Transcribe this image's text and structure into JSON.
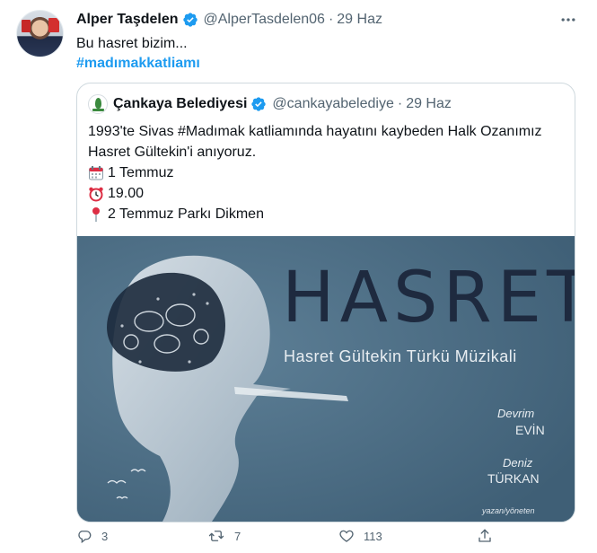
{
  "author": {
    "name": "Alper Taşdelen",
    "handle": "@AlperTasdelen06",
    "separator": "·",
    "date": "29 Haz"
  },
  "tweet": {
    "text": "Bu hasret bizim...",
    "hashtag": "#madımakkatliamı"
  },
  "quoted": {
    "name": "Çankaya Belediyesi",
    "handle": "@cankayabelediye",
    "separator": "·",
    "date": "29 Haz",
    "line1": "1993'te Sivas #Madımak katliamında hayatını kaybeden Halk Ozanımız",
    "line2": "Hasret Gültekin'i anıyoruz.",
    "event_date": "1 Temmuz",
    "event_time": "19.00",
    "event_place": "2 Temmuz Parkı Dikmen",
    "media": {
      "title": "HASRET",
      "subtitle": "Hasret Gültekin Türkü Müzikali",
      "person1_first": "Devrim",
      "person1_last": "EVİN",
      "person2_first": "Deniz",
      "person2_last": "TÜRKAN",
      "credit": "yazan/yöneten"
    }
  },
  "actions": {
    "replies": "3",
    "retweets": "7",
    "likes": "113"
  },
  "icons": {
    "more": "more-icon",
    "verified": "verified-badge-icon",
    "calendar": "calendar-emoji-icon",
    "alarm": "alarm-clock-emoji-icon",
    "pin": "round-pushpin-emoji-icon",
    "reply": "reply-icon",
    "retweet": "retweet-icon",
    "like": "heart-icon",
    "share": "share-icon"
  },
  "colors": {
    "link": "#1d9bf0",
    "verified": "#1d9bf0",
    "muted": "#536471",
    "poster_bg": "#4d6e85"
  }
}
